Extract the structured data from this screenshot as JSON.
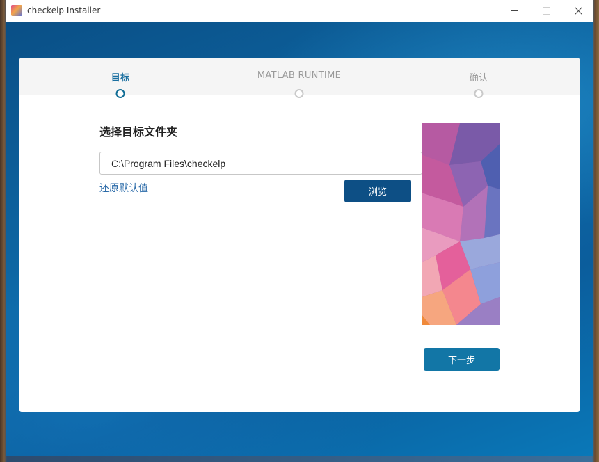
{
  "window": {
    "title": "checkelp Installer"
  },
  "steps": [
    {
      "label": "目标",
      "state": "active"
    },
    {
      "label": "MATLAB RUNTIME",
      "state": "inactive"
    },
    {
      "label": "确认",
      "state": "inactive"
    }
  ],
  "main": {
    "section_title": "选择目标文件夹",
    "path_value": "C:\\Program Files\\checkelp",
    "restore_label": "还原默认值",
    "browse_label": "浏览",
    "next_label": "下一步"
  },
  "colors": {
    "accent": "#0f6c95",
    "browse_button": "#0d4f85",
    "next_button": "#1276a6",
    "link": "#2a6aa8"
  },
  "icons": {
    "minimize": "minimize-icon",
    "maximize": "maximize-icon",
    "close": "close-icon",
    "app": "app-icon"
  }
}
